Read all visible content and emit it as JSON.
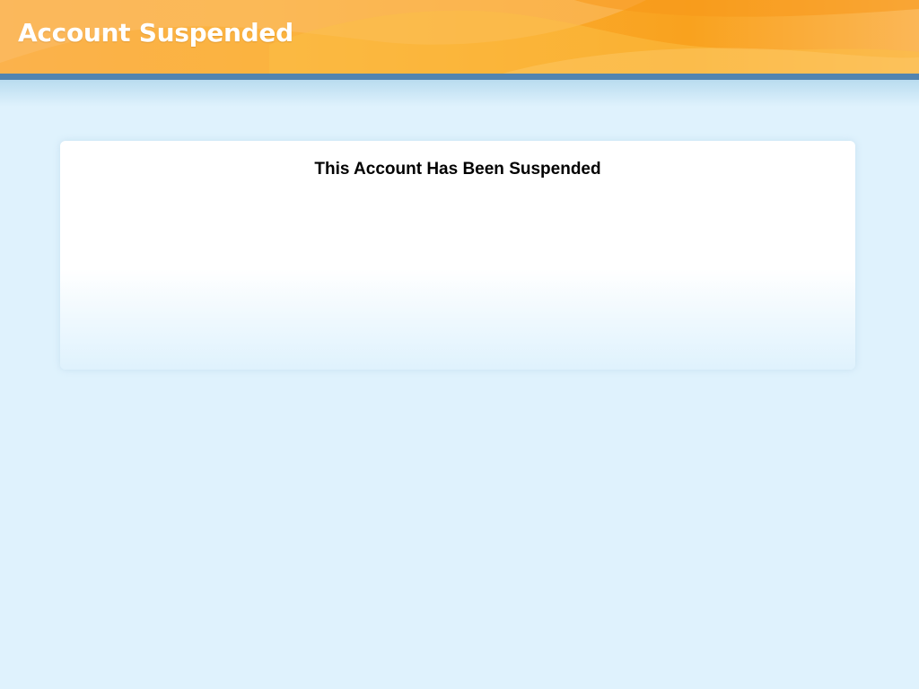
{
  "header": {
    "title": "Account Suspended"
  },
  "main": {
    "heading": "This Account Has Been Suspended"
  },
  "colors": {
    "background": "#dff2fd",
    "header_orange": "#f9a21e",
    "header_bar_blue": "#5284b0",
    "panel": "#ffffff",
    "text_dark": "#000000",
    "text_light": "#ffffff"
  }
}
